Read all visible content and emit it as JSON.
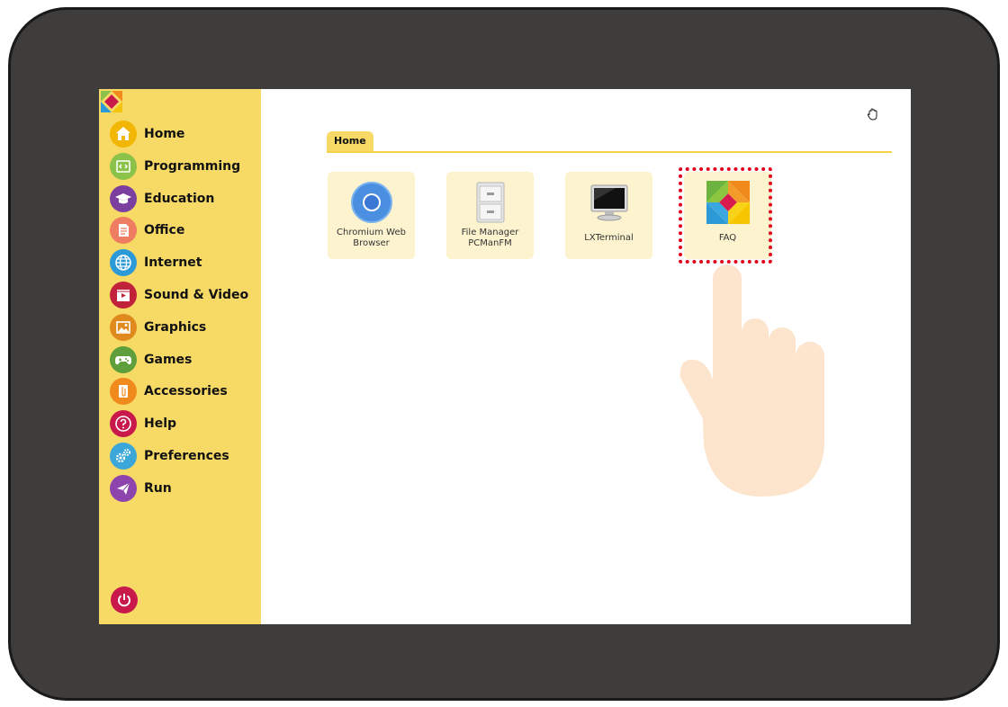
{
  "sidebar": {
    "items": [
      {
        "label": "Home",
        "icon": "home-icon",
        "color": "#f2b705"
      },
      {
        "label": "Programming",
        "icon": "code-icon",
        "color": "#8bc34a"
      },
      {
        "label": "Education",
        "icon": "graduation-cap-icon",
        "color": "#7b3fa0"
      },
      {
        "label": "Office",
        "icon": "document-icon",
        "color": "#ef7d61"
      },
      {
        "label": "Internet",
        "icon": "globe-icon",
        "color": "#2d9ad8"
      },
      {
        "label": "Sound & Video",
        "icon": "video-icon",
        "color": "#c0223b"
      },
      {
        "label": "Graphics",
        "icon": "image-icon",
        "color": "#e08a1e"
      },
      {
        "label": "Games",
        "icon": "gamepad-icon",
        "color": "#5e9e3b"
      },
      {
        "label": "Accessories",
        "icon": "paperclip-icon",
        "color": "#f08a1c"
      },
      {
        "label": "Help",
        "icon": "question-icon",
        "color": "#c9184a"
      },
      {
        "label": "Preferences",
        "icon": "gears-icon",
        "color": "#3aa7d8"
      },
      {
        "label": "Run",
        "icon": "paper-plane-icon",
        "color": "#8e44ad"
      }
    ],
    "power_icon": "power-icon"
  },
  "main": {
    "tab_label": "Home",
    "apps": [
      {
        "label": "Chromium Web Browser",
        "icon": "chromium-icon"
      },
      {
        "label": "File Manager PCManFM",
        "icon": "file-cabinet-icon"
      },
      {
        "label": "LXTerminal",
        "icon": "monitor-icon"
      },
      {
        "label": "FAQ",
        "icon": "faq-logo-icon"
      }
    ]
  },
  "colors": {
    "sidebar_bg": "#f7da66",
    "tile_bg": "#fdf4cf",
    "highlight": "#e3001b",
    "bezel": "#3e3d3b"
  }
}
